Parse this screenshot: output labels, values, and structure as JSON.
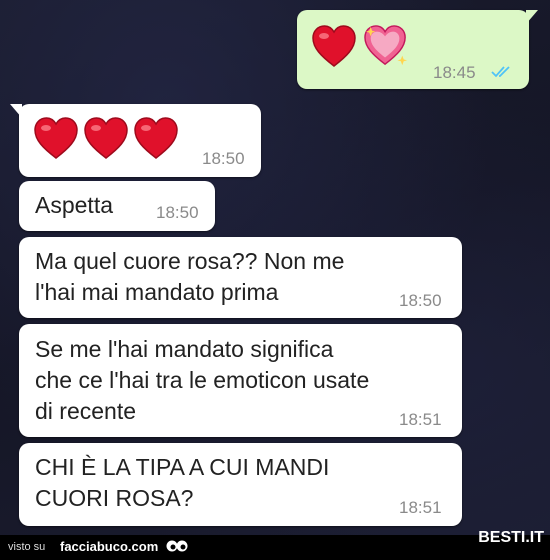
{
  "messages": [
    {
      "kind": "outgoing",
      "content": "hearts",
      "hearts": [
        "red-heart",
        "sparkling-pink-heart"
      ],
      "time": "18:45",
      "status": "read-double-tick"
    },
    {
      "kind": "incoming",
      "content": "hearts",
      "hearts": [
        "red-heart",
        "red-heart",
        "red-heart"
      ],
      "time": "18:50"
    },
    {
      "kind": "incoming",
      "text": "Aspetta",
      "time": "18:50"
    },
    {
      "kind": "incoming",
      "text": "Ma quel cuore rosa?? Non me\nl'hai mai mandato prima",
      "time": "18:50"
    },
    {
      "kind": "incoming",
      "text": "Se me l'hai mandato significa\nche ce l'hai tra le emoticon usate\ndi recente",
      "time": "18:51"
    },
    {
      "kind": "incoming",
      "text": "CHI È LA TIPA A CUI MANDI\nCUORI ROSA?",
      "time": "18:51"
    }
  ],
  "footer": {
    "visto_label": "visto su",
    "site_label": "facciabuco.com",
    "brand_label": "BESTI.IT",
    "eyes_icon": "googly-eyes-icon"
  },
  "colors": {
    "background": "#12131f",
    "incoming_bubble": "#ffffff",
    "outgoing_bubble": "#dcf8c6",
    "read_ticks": "#4fc3f7",
    "heart_red": "#e0112b",
    "heart_pink": "#f06292"
  }
}
